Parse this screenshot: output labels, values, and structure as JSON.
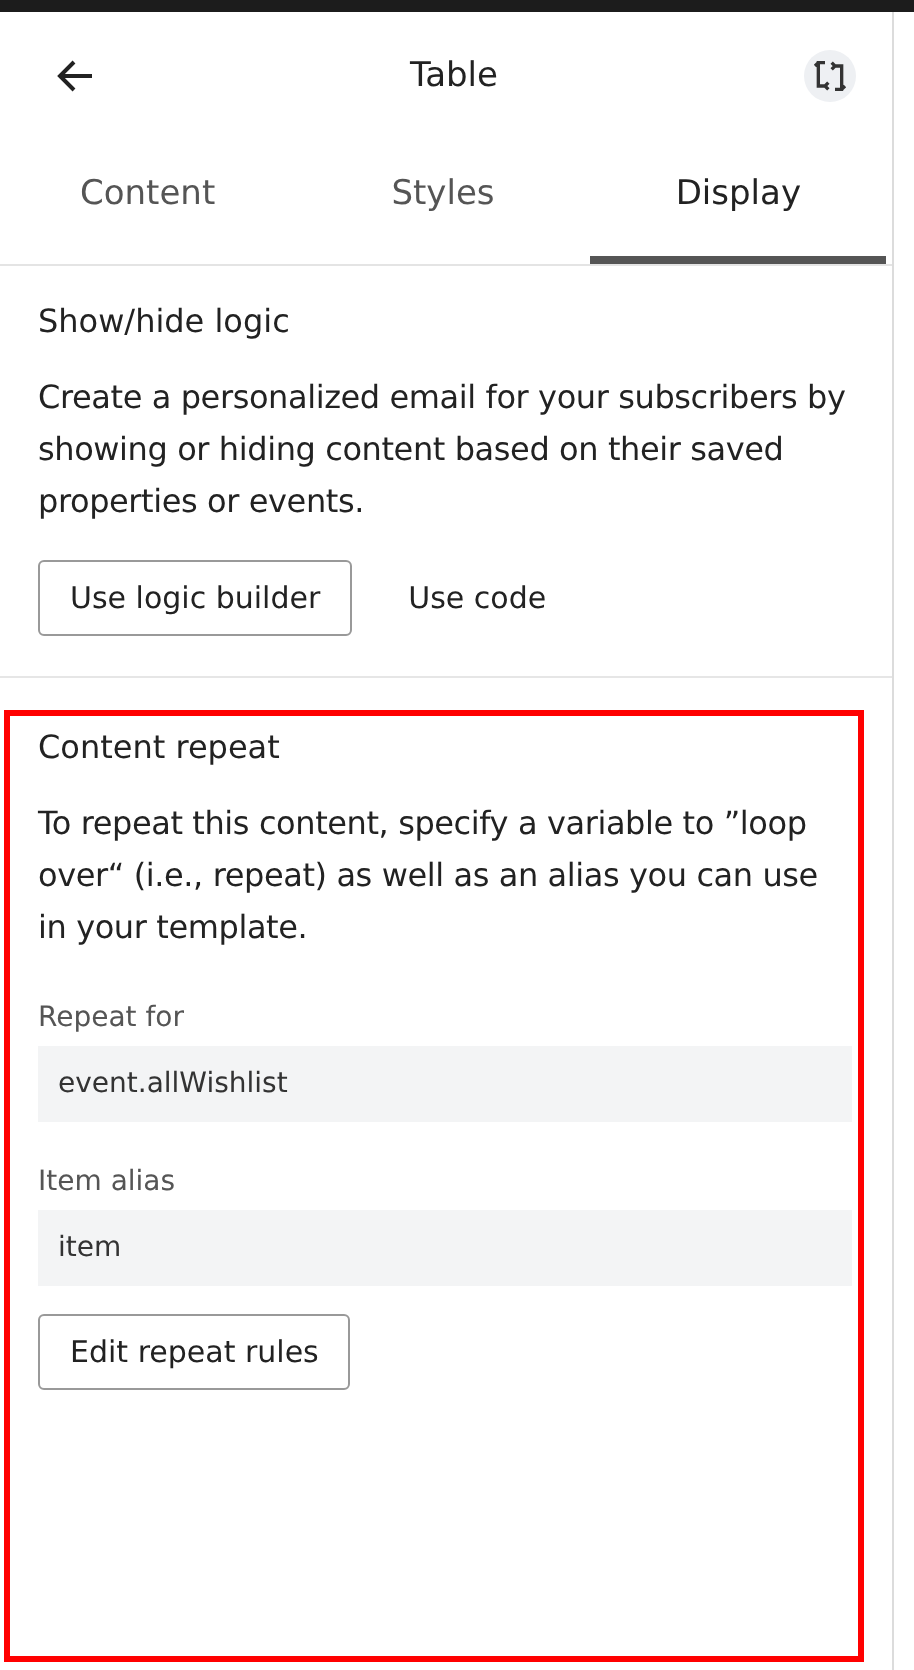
{
  "header": {
    "title": "Table"
  },
  "tabs": [
    {
      "label": "Content",
      "selected": false
    },
    {
      "label": "Styles",
      "selected": false
    },
    {
      "label": "Display",
      "selected": true
    }
  ],
  "logic": {
    "title": "Show/hide logic",
    "text": "Create a personalized email for your subscribers by showing or hiding content based on their saved properties or events.",
    "buttons": [
      {
        "label": "Use logic builder",
        "kind": "outlined"
      },
      {
        "label": "Use code",
        "kind": "plain"
      }
    ]
  },
  "repeat": {
    "title": "Content repeat",
    "text": "To repeat this content, specify a variable to ”loop over“ (i.e., repeat) as well as an alias you can use in your template.",
    "fields": [
      {
        "label": "Repeat for",
        "value": "event.allWishlist"
      },
      {
        "label": "Item alias",
        "value": "item"
      }
    ],
    "button": "Edit repeat rules"
  }
}
